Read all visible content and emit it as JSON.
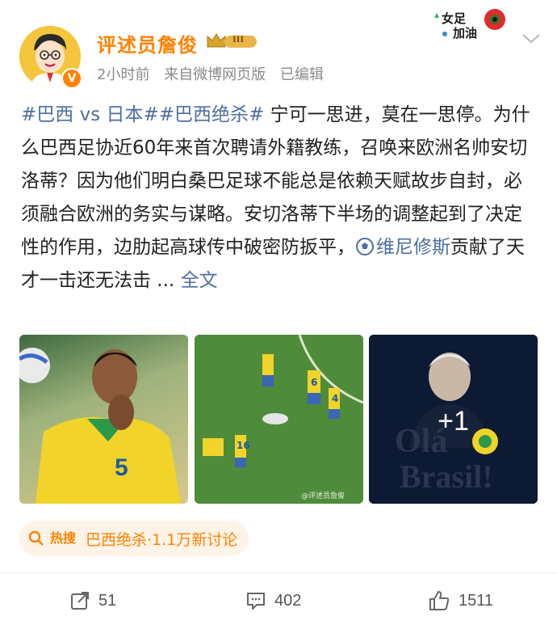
{
  "user": {
    "name": "评述员詹俊",
    "vip_level": "III",
    "verified_mark": "V"
  },
  "meta": {
    "time": "2小时前",
    "source": "来自微博网页版",
    "edited": "已编辑"
  },
  "sticker": {
    "line1": "女足",
    "line2": "加油"
  },
  "post": {
    "hashtag1": "#巴西 vs 日本#",
    "hashtag2": "#巴西绝杀#",
    "text1": " 宁可一思进，莫在一思停。为什么巴西足协近60年来首次聘请外籍教练，召唤来欧洲名帅安切洛蒂？因为他们明白桑巴足球不能总是依赖天赋故步自封，必须融合欧洲的务实与谋略。安切洛蒂下半场的调整起到了决定性的作用，边肋起高球传中破密防扳平，",
    "mention": "维尼修斯",
    "text2": "贡献了天才一击还无法击 ... ",
    "more": "全文"
  },
  "images": {
    "img1_number": "5",
    "img2_numbers": [
      "6",
      "4",
      "16"
    ],
    "img2_watermark": "@评述员詹俊",
    "img3_caption_line1": "Olá",
    "img3_caption_line2": "Brasil!",
    "more_count": "+1"
  },
  "topic": {
    "badge": "热搜",
    "label": "巴西绝杀·1.1万新讨论"
  },
  "actions": {
    "repost": "51",
    "comment": "402",
    "like": "1511"
  },
  "icons": {
    "repost": "share-icon",
    "comment": "comment-icon",
    "like": "thumbs-up-icon",
    "more": "chevron-down-icon",
    "mention": "football-icon",
    "search": "search-icon"
  },
  "colors": {
    "accent": "#ff8200",
    "link": "#4d6fa3",
    "meta": "#8a8a8a",
    "topic_bg": "#fdf3e6"
  }
}
